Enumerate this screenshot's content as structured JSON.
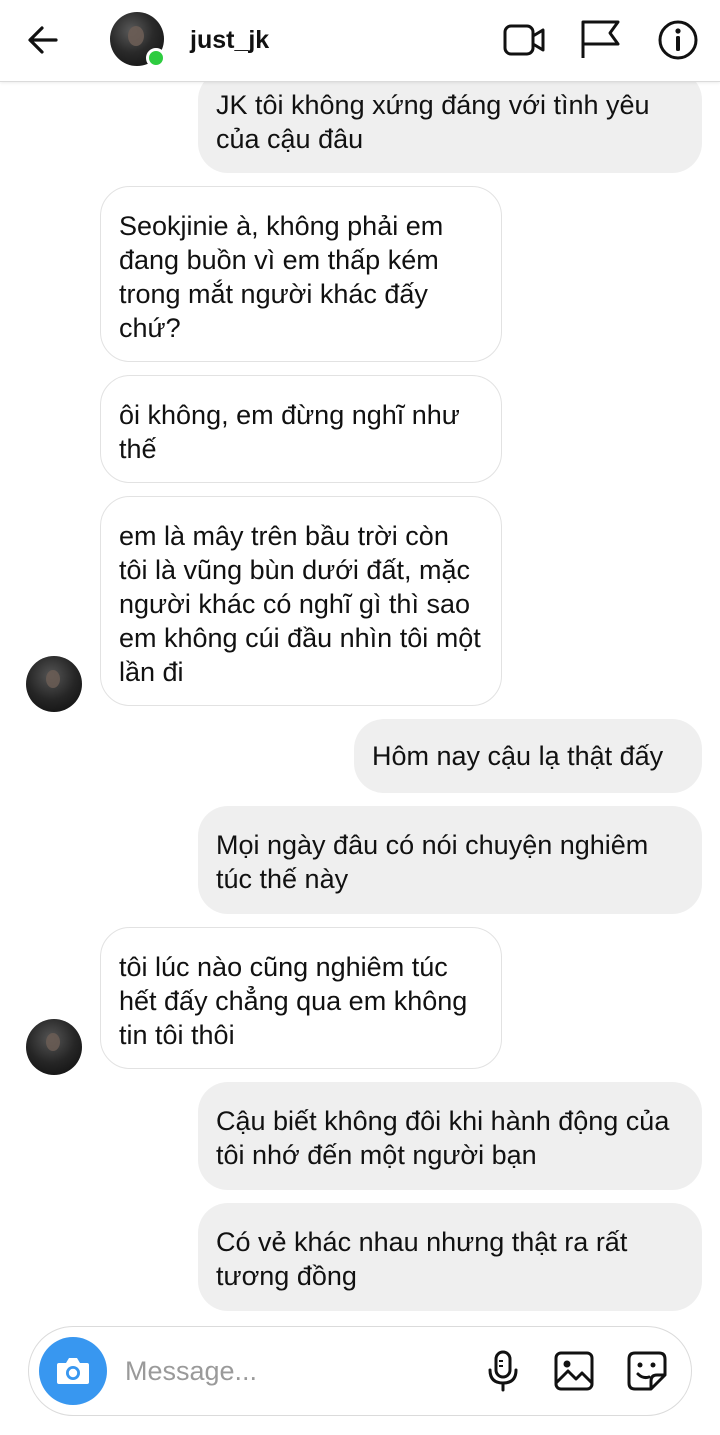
{
  "header": {
    "username": "just_jk",
    "icons": [
      "back-arrow-icon",
      "video-call-icon",
      "flag-icon",
      "info-icon"
    ],
    "online_color": "#2ecc40"
  },
  "messages": [
    {
      "side": "sent",
      "text": "JK tôi không xứng đáng với tình yêu của cậu đâu"
    },
    {
      "side": "received",
      "text": "Seokjinie à, không phải em đang buồn vì em thấp kém trong mắt người khác đấy chứ?"
    },
    {
      "side": "received",
      "text": "ôi không, em đừng nghĩ như thế"
    },
    {
      "side": "received",
      "text": "em là mây trên bầu trời còn tôi là vũng bùn dưới đất, mặc người khác có nghĩ gì thì sao em không cúi đầu nhìn tôi một lần đi"
    },
    {
      "side": "sent",
      "text": "Hôm nay cậu lạ thật đấy"
    },
    {
      "side": "sent",
      "text": "Mọi ngày đâu có nói chuyện nghiêm túc thế này"
    },
    {
      "side": "received",
      "text": "tôi lúc nào cũng nghiêm túc hết đấy chẳng qua em không tin tôi thôi"
    },
    {
      "side": "sent",
      "text": "Cậu biết không đôi khi hành động của tôi nhớ đến một người bạn"
    },
    {
      "side": "sent",
      "text": "Có vẻ khác nhau nhưng thật ra rất tương đồng"
    }
  ],
  "composer": {
    "placeholder": "Message...",
    "camera_color": "#3897f0",
    "icons": [
      "camera-icon",
      "microphone-icon",
      "gallery-icon",
      "sticker-icon"
    ]
  },
  "colors": {
    "sent_bubble": "#efefef",
    "received_border": "#e2e2e2"
  }
}
